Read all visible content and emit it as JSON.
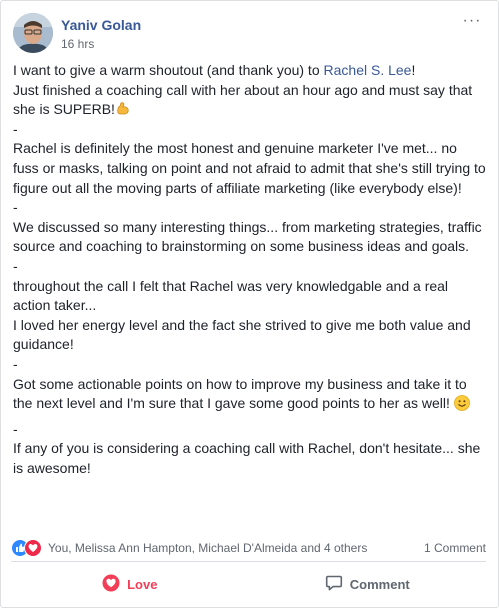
{
  "post": {
    "author": "Yaniv Golan",
    "time": "16 hrs",
    "more_label": "···",
    "body": {
      "line1_pre": "I want to give a warm shoutout (and thank you) to ",
      "mention": "Rachel S. Lee",
      "line1_post": "!",
      "line2": "Just finished a coaching call with her about an hour ago and must say that she is SUPERB!",
      "sep1": "-",
      "para2": "Rachel is definitely the most honest and genuine marketer I've met... no fuss or masks, talking on point and not afraid to admit that she's still trying to figure out all the moving parts of affiliate marketing (like everybody else)!",
      "sep2": "-",
      "para3": "We discussed so many interesting things... from marketing strategies, traffic source and coaching to brainstorming on some business ideas and goals.",
      "sep3": "-",
      "para4a": "throughout the call I felt that Rachel was very knowledgable and a real action taker...",
      "para4b": "I loved her energy level and the fact she strived to give me both value and guidance!",
      "sep4": "-",
      "para5": "Got some actionable points on how to improve my business and take it to the next level and I'm sure that I gave some good points to her as well!",
      "sep5": "-",
      "para6": "If any of you is considering a coaching call with Rachel, don't hesitate... she is awesome!"
    },
    "reactions": {
      "names": "You, Melissa Ann Hampton, Michael D'Almeida and 4 others",
      "comments": "1 Comment"
    },
    "actions": {
      "love_label": "Love",
      "comment_label": "Comment"
    },
    "icons": {
      "avatar": "profile-photo",
      "flexed_biceps": "flexed-biceps-emoji",
      "smile": "smile-emoji",
      "like": "like-reaction-icon",
      "love": "love-reaction-icon",
      "comment": "comment-icon"
    },
    "colors": {
      "link": "#385898",
      "love": "#f33e58",
      "like": "#2d88ff",
      "muted": "#606770"
    }
  }
}
